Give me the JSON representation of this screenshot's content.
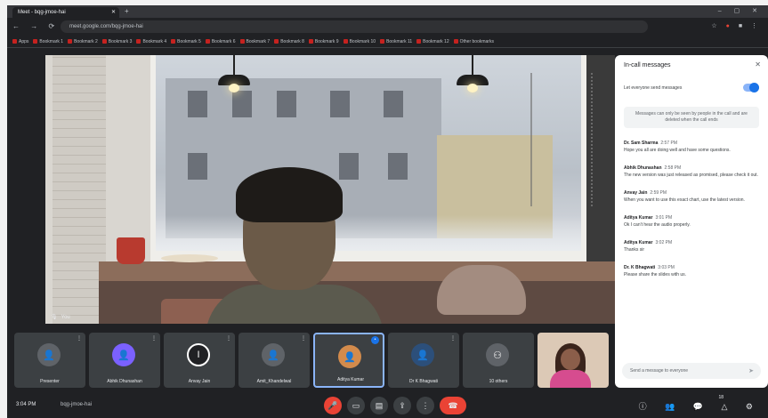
{
  "browser": {
    "tab_title": "Meet - bqg-jmoe-hai",
    "omnibox_text": "meet.google.com/bqg-jmoe-hai",
    "bookmarks": [
      "Apps",
      "Bookmark 1",
      "Bookmark 2",
      "Bookmark 3",
      "Bookmark 4",
      "Bookmark 5",
      "Bookmark 6",
      "Bookmark 7",
      "Bookmark 8",
      "Bookmark 9",
      "Bookmark 10",
      "Bookmark 11",
      "Bookmark 12",
      "Other bookmarks"
    ]
  },
  "main_video": {
    "speaker_name": "You"
  },
  "participants": [
    {
      "name": "Presenter",
      "initial": "",
      "color": "#5f6368",
      "icon": "person-silhouette"
    },
    {
      "name": "Abhik Dhunashan",
      "initial": "",
      "color": "#7b61ff",
      "icon": "person-silhouette"
    },
    {
      "name": "Anvay Jain",
      "initial": "I",
      "color": "#202124",
      "icon": "letter-avatar"
    },
    {
      "name": "Amit_Khandelwal",
      "initial": "",
      "color": "#5f6368",
      "icon": "person-silhouette"
    },
    {
      "name": "Aditya Kumar",
      "initial": "",
      "color": "#d38b4c",
      "icon": "person-photo"
    },
    {
      "name": "Dr K Bhagwati",
      "initial": "",
      "color": "#2c4f7a",
      "icon": "person-silhouette"
    },
    {
      "name": "10 others",
      "initial": "",
      "color": "#5f6368",
      "icon": "others-avatars"
    },
    {
      "name": "",
      "initial": "",
      "color": "#d64c8f",
      "icon": "person-photo"
    }
  ],
  "bottom_bar": {
    "time": "3:04 PM",
    "meeting_code": "bqg-jmoe-hai",
    "participant_count": "18"
  },
  "chat": {
    "title": "In-call messages",
    "toggle_label": "Let everyone send messages",
    "notice": "Messages can only be seen by people in the call and are deleted when the call ends",
    "messages": [
      {
        "sender": "Dr. Sam Sharma",
        "time": "2:57 PM",
        "text": "Hope you all are doing well and have some questions."
      },
      {
        "sender": "Abhik Dhunashan",
        "time": "2:58 PM",
        "text": "The new version was just released as promised, please check it out."
      },
      {
        "sender": "Anvay Jain",
        "time": "2:59 PM",
        "text": "When you want to use this exact chart, use the latest version."
      },
      {
        "sender": "Aditya Kumar",
        "time": "3:01 PM",
        "text": "Ok I can't hear the audio properly."
      },
      {
        "sender": "Aditya Kumar",
        "time": "3:02 PM",
        "text": "Thanks sir"
      },
      {
        "sender": "Dr. K Bhagwati",
        "time": "3:03 PM",
        "text": "Please share the slides with us."
      }
    ],
    "input_placeholder": "Send a message to everyone"
  }
}
